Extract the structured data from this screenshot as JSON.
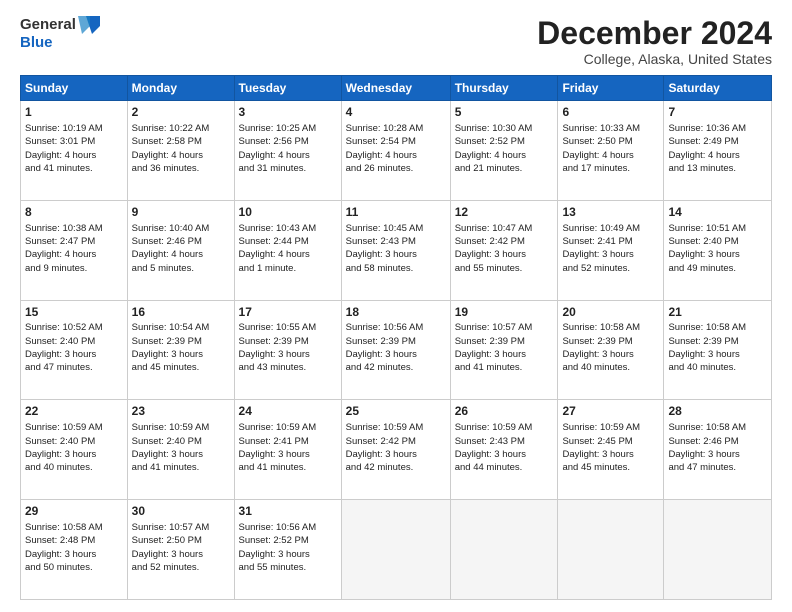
{
  "logo": {
    "line1": "General",
    "line2": "Blue"
  },
  "title": "December 2024",
  "subtitle": "College, Alaska, United States",
  "days_header": [
    "Sunday",
    "Monday",
    "Tuesday",
    "Wednesday",
    "Thursday",
    "Friday",
    "Saturday"
  ],
  "weeks": [
    [
      {
        "day": 1,
        "lines": [
          "Sunrise: 10:19 AM",
          "Sunset: 3:01 PM",
          "Daylight: 4 hours",
          "and 41 minutes."
        ]
      },
      {
        "day": 2,
        "lines": [
          "Sunrise: 10:22 AM",
          "Sunset: 2:58 PM",
          "Daylight: 4 hours",
          "and 36 minutes."
        ]
      },
      {
        "day": 3,
        "lines": [
          "Sunrise: 10:25 AM",
          "Sunset: 2:56 PM",
          "Daylight: 4 hours",
          "and 31 minutes."
        ]
      },
      {
        "day": 4,
        "lines": [
          "Sunrise: 10:28 AM",
          "Sunset: 2:54 PM",
          "Daylight: 4 hours",
          "and 26 minutes."
        ]
      },
      {
        "day": 5,
        "lines": [
          "Sunrise: 10:30 AM",
          "Sunset: 2:52 PM",
          "Daylight: 4 hours",
          "and 21 minutes."
        ]
      },
      {
        "day": 6,
        "lines": [
          "Sunrise: 10:33 AM",
          "Sunset: 2:50 PM",
          "Daylight: 4 hours",
          "and 17 minutes."
        ]
      },
      {
        "day": 7,
        "lines": [
          "Sunrise: 10:36 AM",
          "Sunset: 2:49 PM",
          "Daylight: 4 hours",
          "and 13 minutes."
        ]
      }
    ],
    [
      {
        "day": 8,
        "lines": [
          "Sunrise: 10:38 AM",
          "Sunset: 2:47 PM",
          "Daylight: 4 hours",
          "and 9 minutes."
        ]
      },
      {
        "day": 9,
        "lines": [
          "Sunrise: 10:40 AM",
          "Sunset: 2:46 PM",
          "Daylight: 4 hours",
          "and 5 minutes."
        ]
      },
      {
        "day": 10,
        "lines": [
          "Sunrise: 10:43 AM",
          "Sunset: 2:44 PM",
          "Daylight: 4 hours",
          "and 1 minute."
        ]
      },
      {
        "day": 11,
        "lines": [
          "Sunrise: 10:45 AM",
          "Sunset: 2:43 PM",
          "Daylight: 3 hours",
          "and 58 minutes."
        ]
      },
      {
        "day": 12,
        "lines": [
          "Sunrise: 10:47 AM",
          "Sunset: 2:42 PM",
          "Daylight: 3 hours",
          "and 55 minutes."
        ]
      },
      {
        "day": 13,
        "lines": [
          "Sunrise: 10:49 AM",
          "Sunset: 2:41 PM",
          "Daylight: 3 hours",
          "and 52 minutes."
        ]
      },
      {
        "day": 14,
        "lines": [
          "Sunrise: 10:51 AM",
          "Sunset: 2:40 PM",
          "Daylight: 3 hours",
          "and 49 minutes."
        ]
      }
    ],
    [
      {
        "day": 15,
        "lines": [
          "Sunrise: 10:52 AM",
          "Sunset: 2:40 PM",
          "Daylight: 3 hours",
          "and 47 minutes."
        ]
      },
      {
        "day": 16,
        "lines": [
          "Sunrise: 10:54 AM",
          "Sunset: 2:39 PM",
          "Daylight: 3 hours",
          "and 45 minutes."
        ]
      },
      {
        "day": 17,
        "lines": [
          "Sunrise: 10:55 AM",
          "Sunset: 2:39 PM",
          "Daylight: 3 hours",
          "and 43 minutes."
        ]
      },
      {
        "day": 18,
        "lines": [
          "Sunrise: 10:56 AM",
          "Sunset: 2:39 PM",
          "Daylight: 3 hours",
          "and 42 minutes."
        ]
      },
      {
        "day": 19,
        "lines": [
          "Sunrise: 10:57 AM",
          "Sunset: 2:39 PM",
          "Daylight: 3 hours",
          "and 41 minutes."
        ]
      },
      {
        "day": 20,
        "lines": [
          "Sunrise: 10:58 AM",
          "Sunset: 2:39 PM",
          "Daylight: 3 hours",
          "and 40 minutes."
        ]
      },
      {
        "day": 21,
        "lines": [
          "Sunrise: 10:58 AM",
          "Sunset: 2:39 PM",
          "Daylight: 3 hours",
          "and 40 minutes."
        ]
      }
    ],
    [
      {
        "day": 22,
        "lines": [
          "Sunrise: 10:59 AM",
          "Sunset: 2:40 PM",
          "Daylight: 3 hours",
          "and 40 minutes."
        ]
      },
      {
        "day": 23,
        "lines": [
          "Sunrise: 10:59 AM",
          "Sunset: 2:40 PM",
          "Daylight: 3 hours",
          "and 41 minutes."
        ]
      },
      {
        "day": 24,
        "lines": [
          "Sunrise: 10:59 AM",
          "Sunset: 2:41 PM",
          "Daylight: 3 hours",
          "and 41 minutes."
        ]
      },
      {
        "day": 25,
        "lines": [
          "Sunrise: 10:59 AM",
          "Sunset: 2:42 PM",
          "Daylight: 3 hours",
          "and 42 minutes."
        ]
      },
      {
        "day": 26,
        "lines": [
          "Sunrise: 10:59 AM",
          "Sunset: 2:43 PM",
          "Daylight: 3 hours",
          "and 44 minutes."
        ]
      },
      {
        "day": 27,
        "lines": [
          "Sunrise: 10:59 AM",
          "Sunset: 2:45 PM",
          "Daylight: 3 hours",
          "and 45 minutes."
        ]
      },
      {
        "day": 28,
        "lines": [
          "Sunrise: 10:58 AM",
          "Sunset: 2:46 PM",
          "Daylight: 3 hours",
          "and 47 minutes."
        ]
      }
    ],
    [
      {
        "day": 29,
        "lines": [
          "Sunrise: 10:58 AM",
          "Sunset: 2:48 PM",
          "Daylight: 3 hours",
          "and 50 minutes."
        ]
      },
      {
        "day": 30,
        "lines": [
          "Sunrise: 10:57 AM",
          "Sunset: 2:50 PM",
          "Daylight: 3 hours",
          "and 52 minutes."
        ]
      },
      {
        "day": 31,
        "lines": [
          "Sunrise: 10:56 AM",
          "Sunset: 2:52 PM",
          "Daylight: 3 hours",
          "and 55 minutes."
        ]
      },
      null,
      null,
      null,
      null
    ]
  ]
}
